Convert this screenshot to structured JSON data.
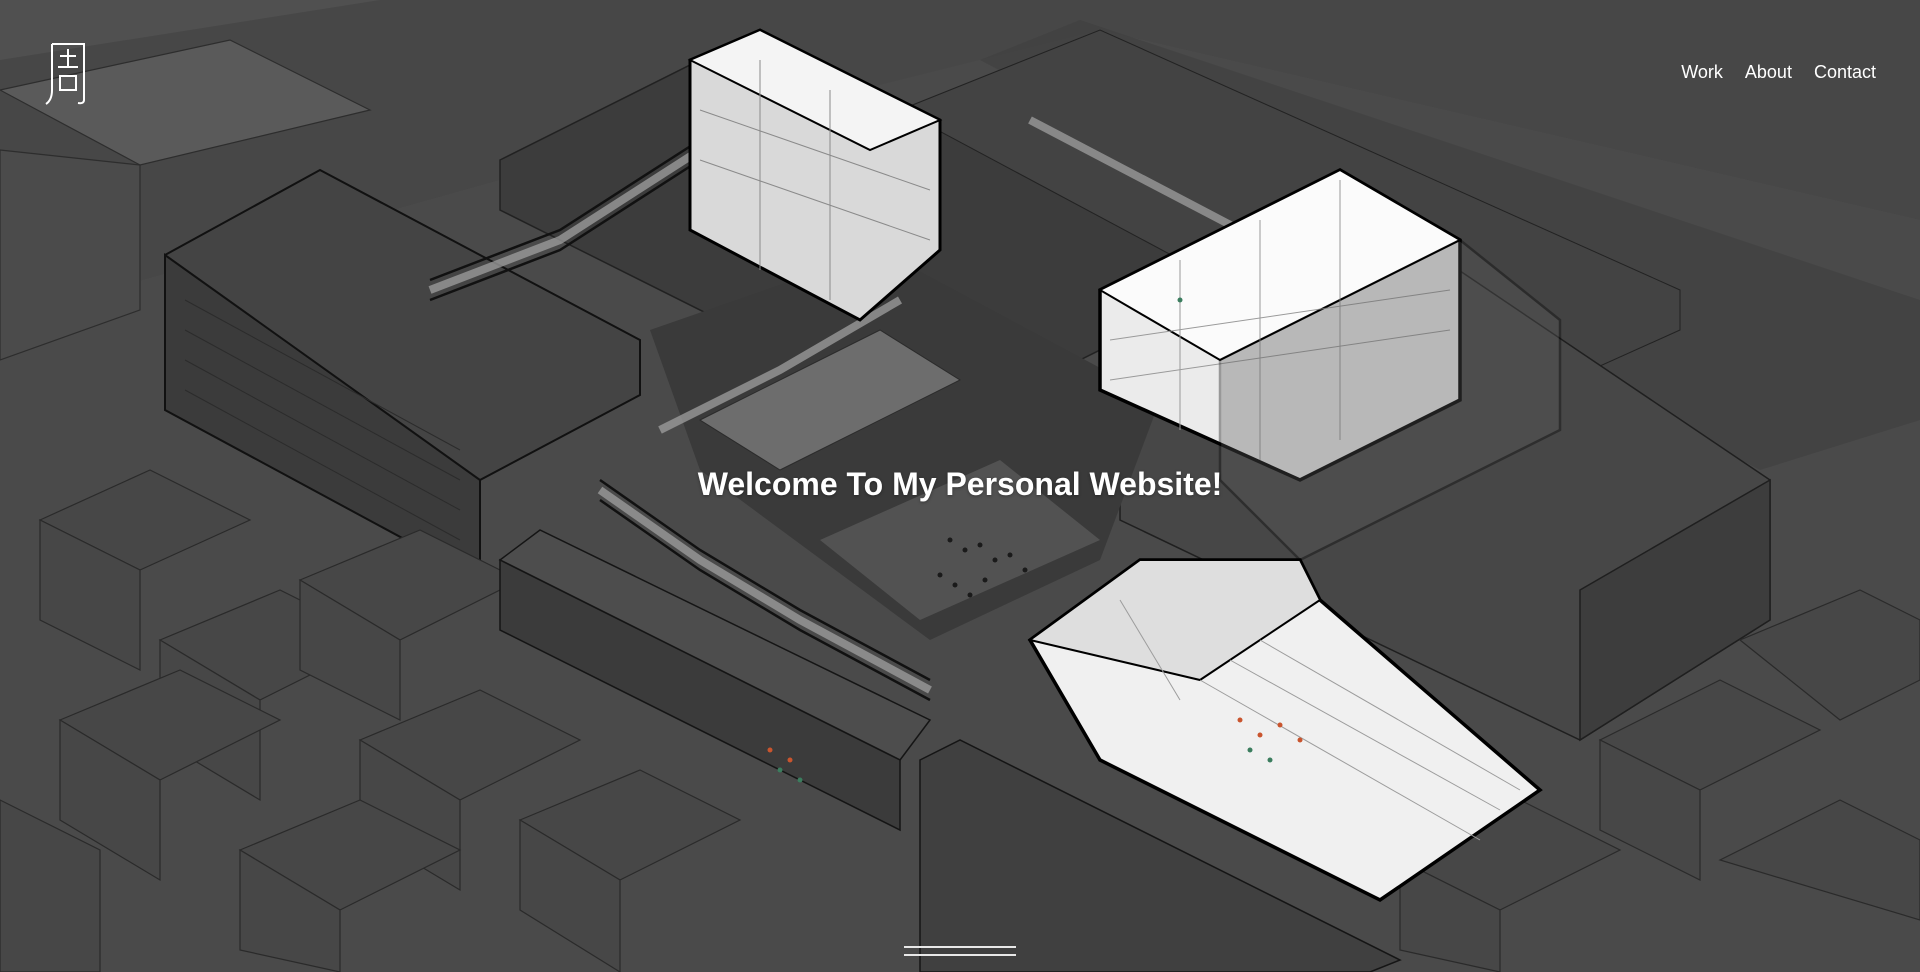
{
  "header": {
    "logo_alt": "周",
    "nav": [
      {
        "label": "Work"
      },
      {
        "label": "About"
      },
      {
        "label": "Contact"
      }
    ]
  },
  "hero": {
    "title": "Welcome To My Personal Website!",
    "image_description": "axonometric architectural drawing",
    "colors": {
      "background": "#4f4f4f",
      "building_dark": "#3a3a3a",
      "building_light": "#f2f2f2",
      "text": "#ffffff"
    }
  }
}
